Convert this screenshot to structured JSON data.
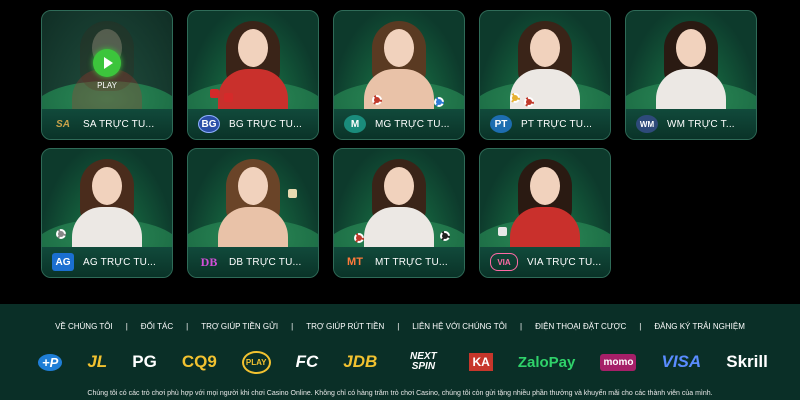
{
  "providers": [
    {
      "id": "sa",
      "name": "SA TRỰC TU...",
      "logo": "SA",
      "logo_color": "#c8a24a",
      "play": "PLAY"
    },
    {
      "id": "bg",
      "name": "BG TRỰC TU...",
      "logo": "BG",
      "logo_color": "#4f7fe0"
    },
    {
      "id": "mg",
      "name": "MG TRỰC TU...",
      "logo": "M",
      "logo_color": "#2bb3a0"
    },
    {
      "id": "pt",
      "name": "PT TRỰC TU...",
      "logo": "PT",
      "logo_color": "#3ea5e6"
    },
    {
      "id": "wm",
      "name": "WM TRỰC T...",
      "logo": "WM",
      "logo_color": "#6fa0d8"
    },
    {
      "id": "ag",
      "name": "AG TRỰC TU...",
      "logo": "AG",
      "logo_color": "#2d8ae0"
    },
    {
      "id": "db",
      "name": "DB TRỰC TU...",
      "logo": "DB",
      "logo_color": "#b23bb8"
    },
    {
      "id": "mt",
      "name": "MT TRỰC TU...",
      "logo": "MT",
      "logo_color": "#e0622d"
    },
    {
      "id": "via",
      "name": "VIA TRỰC TU...",
      "logo": "VIA",
      "logo_color": "#d94a8a"
    }
  ],
  "footer": {
    "nav": [
      "VỀ CHÚNG TÔI",
      "ĐỐI TÁC",
      "TRỢ GIÚP TIỀN GỬI",
      "TRỢ GIÚP RÚT TIỀN",
      "LIÊN HỆ VỚI CHÚNG TÔI",
      "ĐIỆN THOẠI ĐẶT CƯỢC",
      "ĐĂNG KÝ TRẢI NGHIỆM"
    ],
    "separator": "|",
    "partners": [
      {
        "name": "+P",
        "color": "#49b6ff"
      },
      {
        "name": "JL",
        "color": "#f2c230"
      },
      {
        "name": "PG",
        "color": "#ffffff"
      },
      {
        "name": "CQ9",
        "color": "#f2c230"
      },
      {
        "name": "PLAY",
        "color": "#f2c230"
      },
      {
        "name": "FC",
        "color": "#ffffff"
      },
      {
        "name": "JDB",
        "color": "#f2c230"
      },
      {
        "name": "NEXT SPIN",
        "color": "#ffffff"
      },
      {
        "name": "KA",
        "color": "#e04a3a"
      },
      {
        "name": "ZaloPay",
        "color": "#2fd26a"
      },
      {
        "name": "momo",
        "color": "#d82d8b"
      },
      {
        "name": "VISA",
        "color": "#5a8cff"
      },
      {
        "name": "Skrill",
        "color": "#ffffff"
      }
    ],
    "disclaimer": "Chúng tôi có các trò chơi phù hợp với mọi người khi chơi Casino Online. Không chỉ có hàng trăm trò chơi Casino, chúng tôi còn gửi tặng nhiều phần thưởng và khuyến mãi cho các thành viên của mình."
  }
}
